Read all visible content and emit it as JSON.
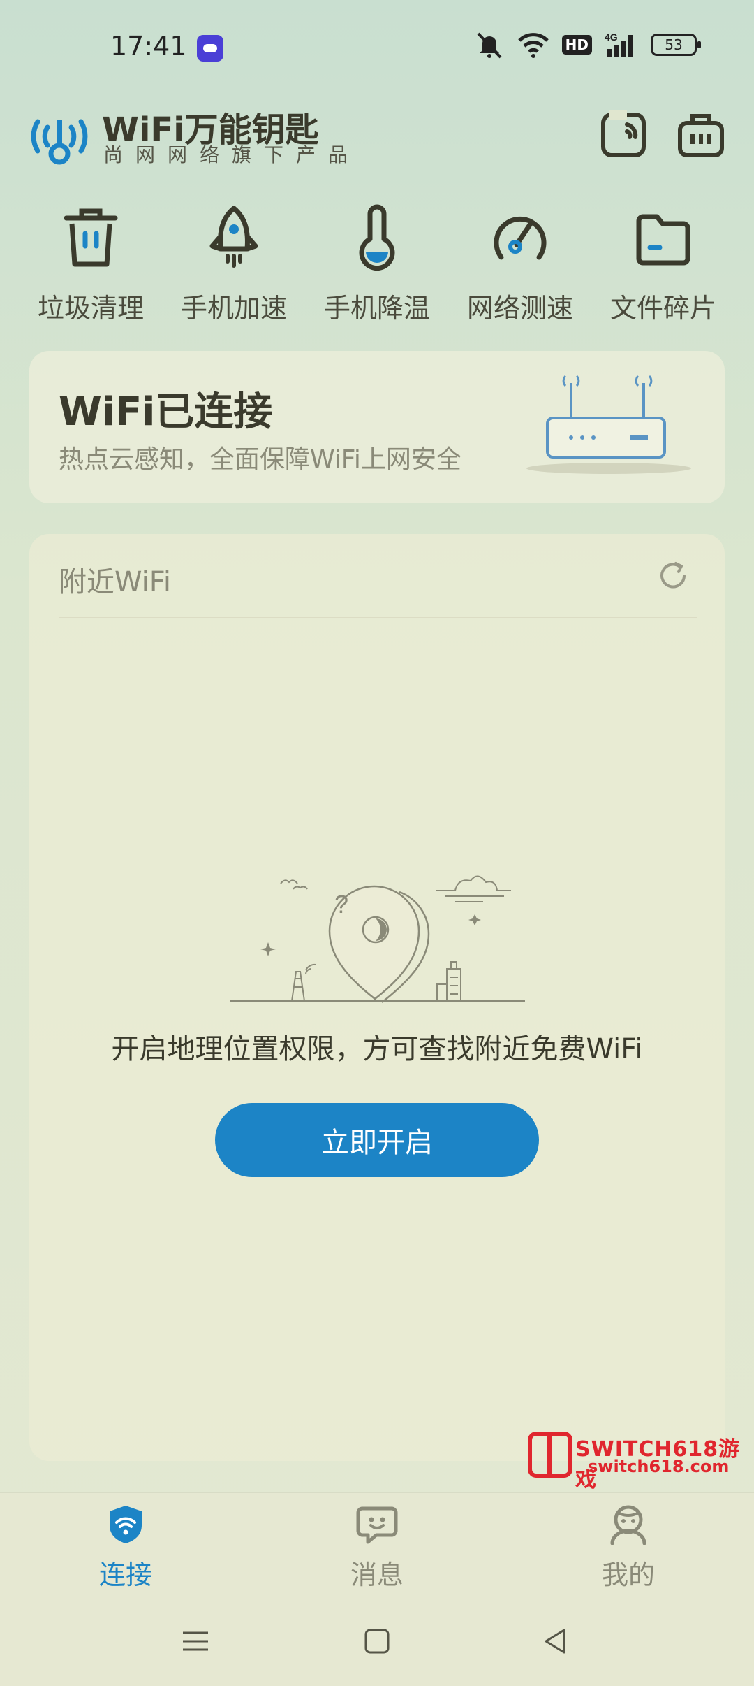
{
  "status_bar": {
    "time": "17:41",
    "hd": "HD",
    "network": "4G",
    "battery": "53"
  },
  "header": {
    "brand_title": "WiFi万能钥匙",
    "brand_subtitle": "尚网网络旗下产品"
  },
  "tools": [
    {
      "label": "垃圾清理",
      "icon": "trash-icon"
    },
    {
      "label": "手机加速",
      "icon": "rocket-icon"
    },
    {
      "label": "手机降温",
      "icon": "thermometer-icon"
    },
    {
      "label": "网络测速",
      "icon": "speedometer-icon"
    },
    {
      "label": "文件碎片",
      "icon": "folder-icon"
    }
  ],
  "connection": {
    "title": "WiFi已连接",
    "subtitle": "热点云感知，全面保障WiFi上网安全"
  },
  "nearby": {
    "title": "附近WiFi",
    "permission_text": "开启地理位置权限，方可查找附近免费WiFi",
    "open_button": "立即开启"
  },
  "watermark": {
    "title": "SWITCH618游戏",
    "url": "switch618.com"
  },
  "bottom_nav": [
    {
      "label": "连接",
      "active": true
    },
    {
      "label": "消息",
      "active": false
    },
    {
      "label": "我的",
      "active": false
    }
  ],
  "colors": {
    "accent": "#1c84c6",
    "text_dark": "#3a3a2c",
    "text_muted": "#8a8a78",
    "watermark": "#e0262e"
  }
}
